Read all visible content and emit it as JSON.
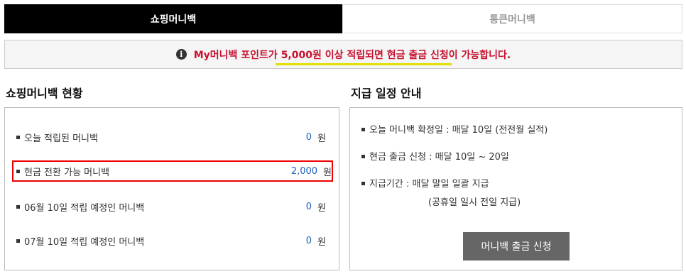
{
  "tabs": {
    "active": "쇼핑머니백",
    "inactive": "통큰머니백"
  },
  "notice": {
    "icon": "info-icon",
    "prefix": "My머니백 포인트가 ",
    "highlight": "5,000원 이상 적립되면 현금 출금 신청",
    "suffix": "이 가능합니다.",
    "color": "#c8102e"
  },
  "status": {
    "title": "쇼핑머니백 현황",
    "rows": [
      {
        "label": "오늘 적립된 머니백",
        "amount": "0",
        "unit": "원"
      },
      {
        "label": "현금 전환 가능 머니백",
        "amount": "2,000",
        "unit": "원"
      },
      {
        "label": "06월 10일 적립 예정인 머니백",
        "amount": "0",
        "unit": "원"
      },
      {
        "label": "07월 10일 적립 예정인 머니백",
        "amount": "0",
        "unit": "원"
      }
    ]
  },
  "schedule": {
    "title": "지급 일정 안내",
    "items": [
      "오늘 머니백 확정일 :  매달 10일 (전전월 실적)",
      "현금 출금 신청 :  매달 10일 ~ 20일",
      "지급기간 :  매달 말일 일괄 지급"
    ],
    "sub_note": "(공휴일 일시 전일 지급)",
    "button_label": "머니백 출금 신청"
  }
}
